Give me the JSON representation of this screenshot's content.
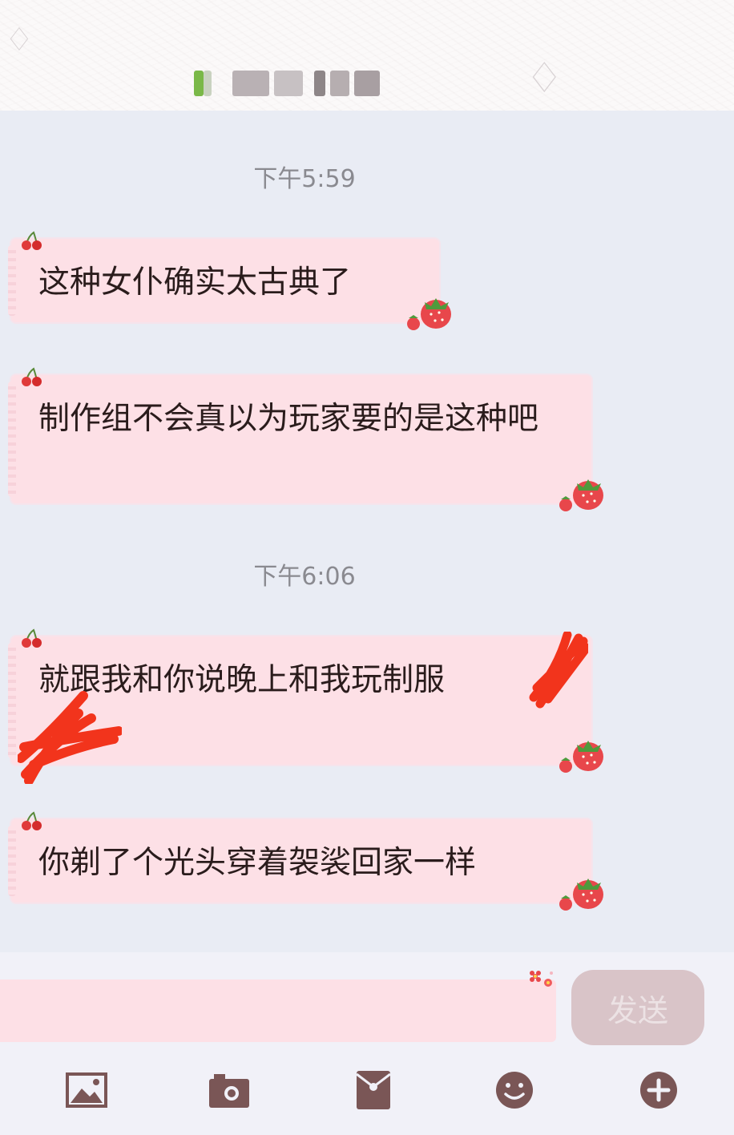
{
  "header": {
    "contact_name": "",
    "sparkle_icon": "sparkle-icon"
  },
  "messages": [
    {
      "type": "timestamp",
      "text": "下午5:59"
    },
    {
      "type": "bubble",
      "text": "这种女仆确实太古典了"
    },
    {
      "type": "bubble",
      "text": "制作组不会真以为玩家要的是这种吧"
    },
    {
      "type": "timestamp",
      "text": "下午6:06"
    },
    {
      "type": "bubble",
      "text": "就跟我和你说晚上和我玩制服"
    },
    {
      "type": "bubble",
      "text": "你剃了个光头穿着袈裟回家一样"
    }
  ],
  "input": {
    "value": "",
    "placeholder": ""
  },
  "send_label": "发送",
  "toolbar": {
    "icons": [
      "image-icon",
      "camera-icon",
      "red-packet-icon",
      "emoji-icon",
      "plus-icon"
    ]
  },
  "colors": {
    "bubble": "#fde0e6",
    "chat_background": "#e9ecf4",
    "icon": "#7a5656",
    "send_button": "#d9c4c8",
    "scribble": "#f2341c"
  }
}
